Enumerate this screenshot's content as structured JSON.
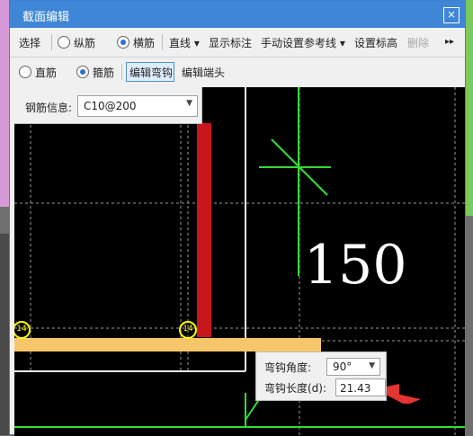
{
  "window": {
    "title": "截面编辑",
    "close": "×"
  },
  "toolbar1": {
    "select": "选择",
    "vertical_rebar": "纵筋",
    "horizontal_rebar": "横筋",
    "line": "直线 ▾",
    "show_annotation": "显示标注",
    "manual_ref_line": "手动设置参考线 ▾",
    "set_elevation": "设置标高",
    "delete": "删除",
    "overflow": "▸▸"
  },
  "toolbar2": {
    "straight_rebar": "直筋",
    "stirrup": "箍筋",
    "edit_hook": "编辑弯钩",
    "edit_end": "编辑端头"
  },
  "canvas": {
    "big_label": "150",
    "rebar_label": "钢筋信息:",
    "rebar_value": "C10@200",
    "circle_1": "14",
    "circle_2": "14"
  },
  "hook_panel": {
    "angle_label": "弯钩角度:",
    "angle_value": "90°",
    "length_label": "弯钩长度(d):",
    "length_value": "21.43"
  },
  "colors": {
    "titlebar": "#3f86d6",
    "rebar_red": "#c8161d",
    "rebar_yellow": "#f7c66a",
    "guide_green": "#33dd33"
  }
}
